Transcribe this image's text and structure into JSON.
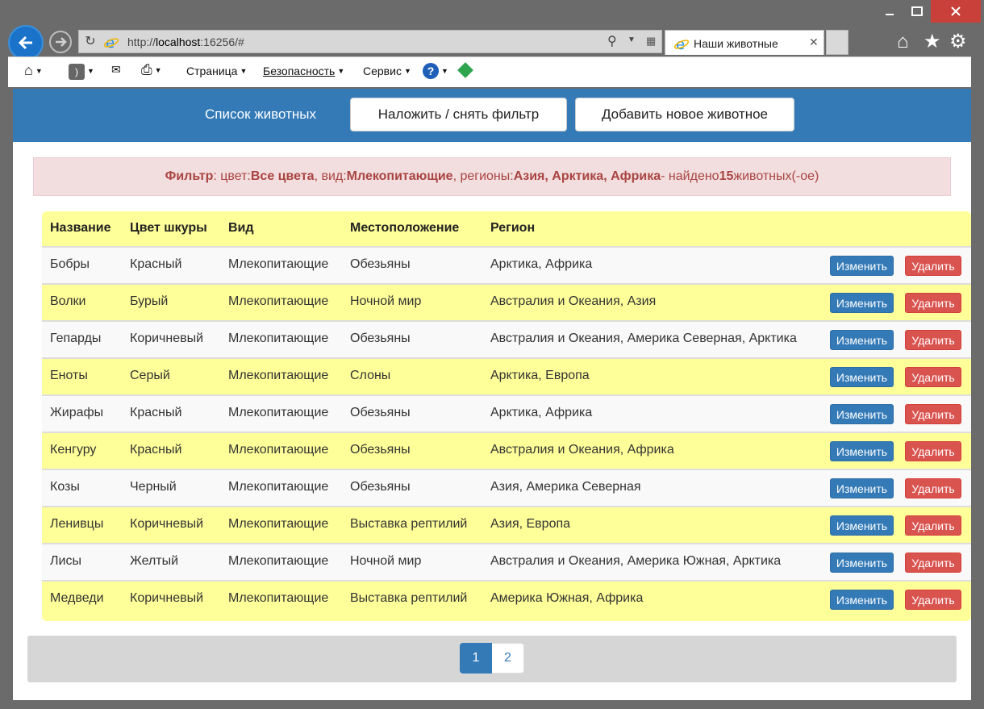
{
  "browser": {
    "address": {
      "prefix": "http://",
      "host": "localhost",
      "rest": ":16256/#"
    },
    "tab_title": "Наши животные",
    "menu": {
      "page": "Страница",
      "security": "Безопасность",
      "service": "Сервис"
    }
  },
  "nav": {
    "brand": "Список животных",
    "filter_button": "Наложить / снять фильтр",
    "add_button": "Добавить новое животное"
  },
  "filter": {
    "label": "Фильтр",
    "color_label": ": цвет: ",
    "color_value": "Все цвета",
    "kind_label": ", вид: ",
    "kind_value": "Млекопитающие",
    "regions_label": ", регионы: ",
    "regions_value": "Азия, Арктика, Африка",
    "found_label": " - найдено ",
    "found_count": "15",
    "found_suffix": " животных(-ое)"
  },
  "table": {
    "headers": [
      "Название",
      "Цвет шкуры",
      "Вид",
      "Местоположение",
      "Регион"
    ],
    "edit_label": "Изменить",
    "delete_label": "Удалить",
    "rows": [
      [
        "Бобры",
        "Красный",
        "Млекопитающие",
        "Обезьяны",
        "Арктика, Африка"
      ],
      [
        "Волки",
        "Бурый",
        "Млекопитающие",
        "Ночной мир",
        "Австралия и Океания, Азия"
      ],
      [
        "Гепарды",
        "Коричневый",
        "Млекопитающие",
        "Обезьяны",
        "Австралия и Океания, Америка Северная, Арктика"
      ],
      [
        "Еноты",
        "Серый",
        "Млекопитающие",
        "Слоны",
        "Арктика, Европа"
      ],
      [
        "Жирафы",
        "Красный",
        "Млекопитающие",
        "Обезьяны",
        "Арктика, Африка"
      ],
      [
        "Кенгуру",
        "Красный",
        "Млекопитающие",
        "Обезьяны",
        "Австралия и Океания, Африка"
      ],
      [
        "Козы",
        "Черный",
        "Млекопитающие",
        "Обезьяны",
        "Азия, Америка Северная"
      ],
      [
        "Ленивцы",
        "Коричневый",
        "Млекопитающие",
        "Выставка рептилий",
        "Азия, Европа"
      ],
      [
        "Лисы",
        "Желтый",
        "Млекопитающие",
        "Ночной мир",
        "Австралия и Океания, Америка Южная, Арктика"
      ],
      [
        "Медведи",
        "Коричневый",
        "Млекопитающие",
        "Выставка рептилий",
        "Америка Южная, Африка"
      ]
    ]
  },
  "pagination": {
    "pages": [
      "1",
      "2"
    ],
    "active": "1"
  },
  "colors": {
    "primary": "#337ab7",
    "danger": "#d9534f",
    "row_highlight": "#ffff99",
    "alert_bg": "#f2dede",
    "alert_text": "#a94442"
  },
  "icons": [
    "back-icon",
    "forward-icon",
    "refresh-icon",
    "ie-logo-icon",
    "search-icon",
    "compat-view-icon",
    "home-icon",
    "favorites-star-icon",
    "gear-icon",
    "feeds-icon",
    "mail-icon",
    "print-icon",
    "help-icon"
  ]
}
